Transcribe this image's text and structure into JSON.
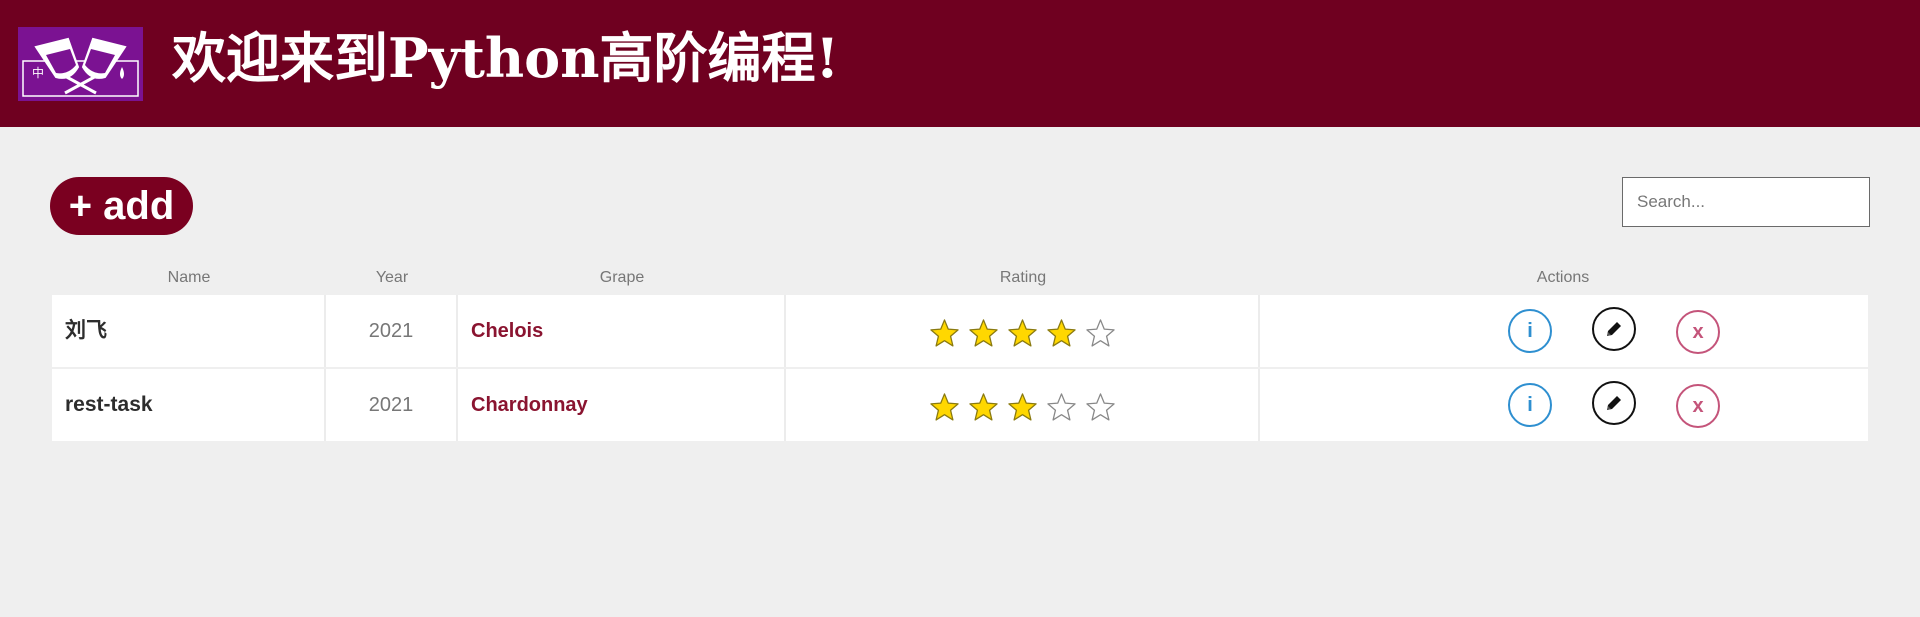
{
  "header": {
    "title": "欢迎来到Python高阶编程!",
    "logo_text": "中",
    "bg_color": "#6f0020"
  },
  "toolbar": {
    "add_label": "+ add",
    "search_placeholder": "Search...",
    "search_value": ""
  },
  "table": {
    "columns": [
      "Name",
      "Year",
      "Grape",
      "Rating",
      "Actions"
    ],
    "rows": [
      {
        "name": "刘飞",
        "year": "2021",
        "grape": "Chelois",
        "rating": 4,
        "max_rating": 5,
        "actions": {
          "info": "i",
          "edit": "pencil-icon",
          "delete": "x"
        }
      },
      {
        "name": "rest-task",
        "year": "2021",
        "grape": "Chardonnay",
        "rating": 3,
        "max_rating": 5,
        "actions": {
          "info": "i",
          "edit": "pencil-icon",
          "delete": "x"
        }
      }
    ]
  },
  "colors": {
    "accent": "#7a0020",
    "grape_text": "#8a1430",
    "star_fill": "#ffd700",
    "info": "#2e8fd0",
    "delete": "#c4547a"
  }
}
